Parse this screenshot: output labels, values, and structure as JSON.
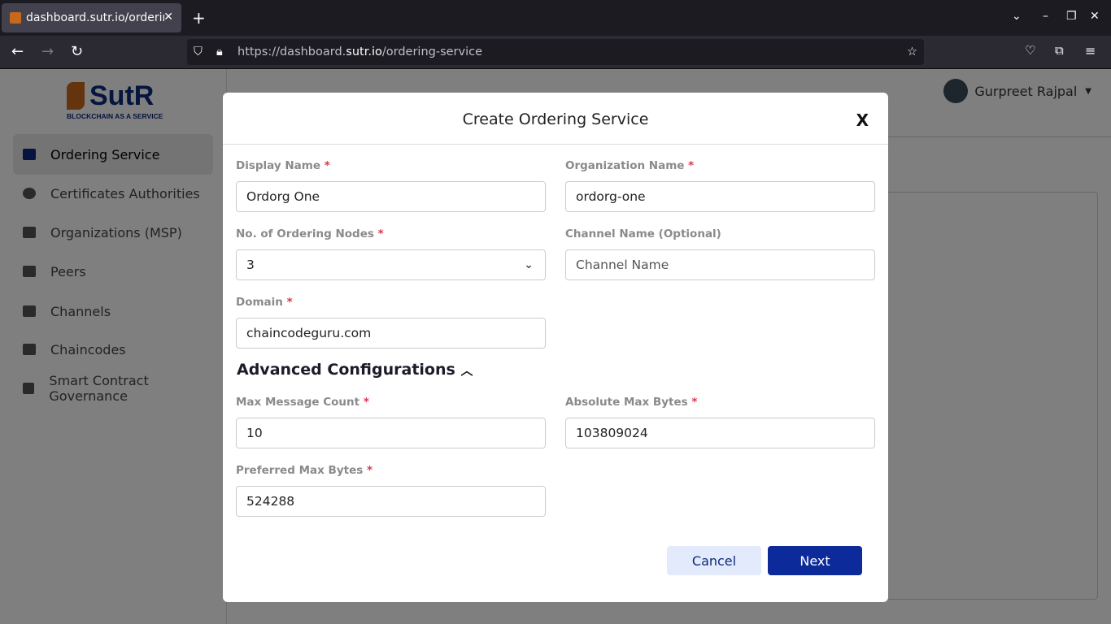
{
  "browser": {
    "tab_title": "dashboard.sutr.io/ordering-service",
    "url_prefix": "https://dashboard.",
    "url_domain": "sutr.io",
    "url_path": "/ordering-service"
  },
  "logo": {
    "name": "SutR",
    "tagline": "BLOCKCHAIN AS A SERVICE"
  },
  "sidebar": {
    "items": [
      {
        "label": "Ordering Service",
        "icon": "archive-icon"
      },
      {
        "label": "Certificates Authorities",
        "icon": "badge-check-icon"
      },
      {
        "label": "Organizations (MSP)",
        "icon": "sitemap-icon"
      },
      {
        "label": "Peers",
        "icon": "users-icon"
      },
      {
        "label": "Channels",
        "icon": "megaphone-icon"
      },
      {
        "label": "Chaincodes",
        "icon": "file-code-icon"
      },
      {
        "label": "Smart Contract Governance",
        "icon": "landmark-icon"
      }
    ]
  },
  "user": {
    "name": "Gurpreet Rajpal"
  },
  "modal": {
    "title": "Create Ordering Service",
    "close": "X",
    "fields": {
      "display_name": {
        "label": "Display Name",
        "value": "Ordorg One"
      },
      "org_name": {
        "label": "Organization Name",
        "value": "ordorg-one"
      },
      "nodes": {
        "label": "No. of Ordering Nodes",
        "value": "3"
      },
      "channel": {
        "label": "Channel Name (Optional)",
        "placeholder": "Channel Name"
      },
      "domain": {
        "label": "Domain",
        "value": "chaincodeguru.com"
      },
      "max_msg": {
        "label": "Max Message Count",
        "value": "10"
      },
      "abs_max": {
        "label": "Absolute Max Bytes",
        "value": "103809024"
      },
      "pref_max": {
        "label": "Preferred Max Bytes",
        "value": "524288"
      }
    },
    "required_mark": "*",
    "advanced": "Advanced Configurations",
    "cancel": "Cancel",
    "next": "Next"
  },
  "colors": {
    "primary": "#0d2a9a",
    "brand_orange": "#c7681b",
    "required": "#e0334d"
  }
}
